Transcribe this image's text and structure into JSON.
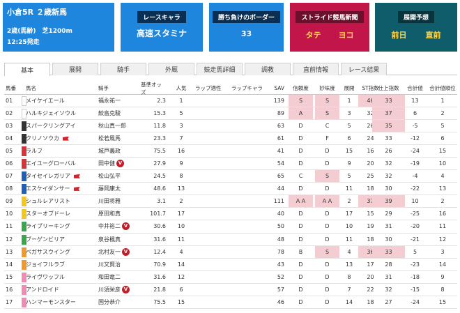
{
  "race_card": {
    "title": "小倉5R ２歳新馬",
    "condition": "2歳(馬齢)　芝1200m",
    "start_time": "12:25発走"
  },
  "chara_card": {
    "header": "レースキャラ",
    "value": "高速スタミナ"
  },
  "border_card": {
    "header": "勝ち負けのボーダー",
    "value": "33"
  },
  "stride_card": {
    "header": "ストライド競馬新聞",
    "left": "タテ",
    "right": "ヨコ"
  },
  "tenkai_card": {
    "header": "展開予想",
    "left": "前日",
    "right": "直前"
  },
  "tabs": [
    "基本",
    "展開",
    "騎手",
    "外厩",
    "競走馬詳細",
    "調教",
    "直前情報",
    "レース結果"
  ],
  "active_tab": 0,
  "columns": [
    "馬番",
    "馬名",
    "騎手",
    "基準オッズ",
    "人気",
    "ラップ適性",
    "ラップキャラ",
    "SAV",
    "信頼度",
    "妙味度",
    "展開",
    "ST指数",
    "仕上指数",
    "合計値",
    "合計値順位"
  ],
  "gate_colors": [
    "#ffffff",
    "#ffffff",
    "#333333",
    "#333333",
    "#d9333a",
    "#d9333a",
    "#1f5fb8",
    "#1f5fb8",
    "#f2c81d",
    "#f2c81d",
    "#39a64b",
    "#39a64b",
    "#f09a2a",
    "#f09a2a",
    "#f08bb5",
    "#f08bb5",
    "#f08bb5"
  ],
  "horses": [
    {
      "no": "01",
      "name": "メイケイエール",
      "jockey": "福永祐一",
      "odds": "2.3",
      "pop": "1",
      "sav": "139",
      "trust": "S",
      "value": "S",
      "tenkai": "1",
      "st": "46",
      "shiage": "33",
      "total": "13",
      "rank": "1",
      "flag": false,
      "vmark": false
    },
    {
      "no": "02",
      "name": "ハルキジェイソウル",
      "jockey": "鮫島克駿",
      "odds": "15.3",
      "pop": "5",
      "sav": "89",
      "trust": "A",
      "value": "S",
      "tenkai": "3",
      "st": "32",
      "shiage": "37",
      "total": "6",
      "rank": "2",
      "flag": false,
      "vmark": false
    },
    {
      "no": "03",
      "name": "スパークリングアイ",
      "jockey": "秋山真一郎",
      "odds": "11.8",
      "pop": "3",
      "sav": "63",
      "trust": "D",
      "value": "C",
      "tenkai": "5",
      "st": "26",
      "shiage": "35",
      "total": "-5",
      "rank": "5",
      "flag": false,
      "vmark": false
    },
    {
      "no": "04",
      "name": "クリノソウカ",
      "jockey": "松若風馬",
      "odds": "23.3",
      "pop": "7",
      "sav": "61",
      "trust": "D",
      "value": "F",
      "tenkai": "6",
      "st": "24",
      "shiage": "33",
      "total": "-12",
      "rank": "6",
      "flag": true,
      "vmark": false
    },
    {
      "no": "05",
      "name": "ラルフ",
      "jockey": "城戸義政",
      "odds": "75.5",
      "pop": "16",
      "sav": "41",
      "trust": "D",
      "value": "D",
      "tenkai": "15",
      "st": "16",
      "shiage": "26",
      "total": "-24",
      "rank": "15",
      "flag": false,
      "vmark": false
    },
    {
      "no": "06",
      "name": "エイユーグローバル",
      "jockey": "田中健",
      "odds": "27.9",
      "pop": "9",
      "sav": "54",
      "trust": "D",
      "value": "D",
      "tenkai": "9",
      "st": "20",
      "shiage": "32",
      "total": "-19",
      "rank": "10",
      "flag": false,
      "vmark": true
    },
    {
      "no": "07",
      "name": "タイセイレガリア",
      "jockey": "松山弘平",
      "odds": "24.5",
      "pop": "8",
      "sav": "65",
      "trust": "C",
      "value": "S",
      "tenkai": "5",
      "st": "25",
      "shiage": "32",
      "total": "-4",
      "rank": "4",
      "flag": true,
      "vmark": false
    },
    {
      "no": "08",
      "name": "エスケイダンサー",
      "jockey": "藤岡康太",
      "odds": "48.6",
      "pop": "13",
      "sav": "44",
      "trust": "D",
      "value": "D",
      "tenkai": "11",
      "st": "18",
      "shiage": "30",
      "total": "-22",
      "rank": "13",
      "flag": true,
      "vmark": false
    },
    {
      "no": "09",
      "name": "シュルレアリスト",
      "jockey": "川田将雅",
      "odds": "3.1",
      "pop": "2",
      "sav": "111",
      "trust": "ＡＡ",
      "value": "ＡＡ",
      "tenkai": "2",
      "st": "37",
      "shiage": "39",
      "total": "10",
      "rank": "2",
      "flag": false,
      "vmark": false
    },
    {
      "no": "10",
      "name": "スターオブドーレ",
      "jockey": "原田和真",
      "odds": "101.7",
      "pop": "17",
      "sav": "40",
      "trust": "D",
      "value": "D",
      "tenkai": "17",
      "st": "15",
      "shiage": "29",
      "total": "-25",
      "rank": "16",
      "flag": false,
      "vmark": false
    },
    {
      "no": "11",
      "name": "ライブリーキング",
      "jockey": "中井裕二",
      "odds": "30.6",
      "pop": "10",
      "sav": "50",
      "trust": "D",
      "value": "D",
      "tenkai": "10",
      "st": "19",
      "shiage": "31",
      "total": "-20",
      "rank": "11",
      "flag": false,
      "vmark": true
    },
    {
      "no": "12",
      "name": "ブーゲンビリア",
      "jockey": "泉谷楓真",
      "odds": "31.6",
      "pop": "11",
      "sav": "48",
      "trust": "D",
      "value": "D",
      "tenkai": "11",
      "st": "18",
      "shiage": "30",
      "total": "-21",
      "rank": "12",
      "flag": false,
      "vmark": false
    },
    {
      "no": "13",
      "name": "ペガサスウイング",
      "jockey": "北村友一",
      "odds": "12.4",
      "pop": "4",
      "sav": "78",
      "trust": "B",
      "value": "S",
      "tenkai": "4",
      "st": "36",
      "shiage": "33",
      "total": "5",
      "rank": "3",
      "flag": false,
      "vmark": true
    },
    {
      "no": "14",
      "name": "ジョイフルラブ",
      "jockey": "川又賢治",
      "odds": "70.9",
      "pop": "14",
      "sav": "43",
      "trust": "D",
      "value": "D",
      "tenkai": "13",
      "st": "17",
      "shiage": "28",
      "total": "-23",
      "rank": "14",
      "flag": false,
      "vmark": false
    },
    {
      "no": "15",
      "name": "ライヴワッフル",
      "jockey": "和田竜二",
      "odds": "31.6",
      "pop": "12",
      "sav": "52",
      "trust": "D",
      "value": "D",
      "tenkai": "8",
      "st": "20",
      "shiage": "31",
      "total": "-18",
      "rank": "9",
      "flag": false,
      "vmark": false
    },
    {
      "no": "16",
      "name": "アンドロイド",
      "jockey": "川須栄彦",
      "odds": "21.8",
      "pop": "6",
      "sav": "57",
      "trust": "D",
      "value": "D",
      "tenkai": "7",
      "st": "22",
      "shiage": "32",
      "total": "-15",
      "rank": "8",
      "flag": false,
      "vmark": true
    },
    {
      "no": "17",
      "name": "ハンマーモンスター",
      "jockey": "国分恭介",
      "odds": "75.5",
      "pop": "15",
      "sav": "46",
      "trust": "D",
      "value": "D",
      "tenkai": "14",
      "st": "18",
      "shiage": "27",
      "total": "-24",
      "rank": "15",
      "flag": false,
      "vmark": false
    }
  ],
  "highlights": {
    "trust": [
      "01",
      "02",
      "09"
    ],
    "value": [
      "01",
      "02",
      "07",
      "09",
      "13"
    ],
    "st": [
      "01",
      "09",
      "13"
    ],
    "shiage": [
      "01",
      "02",
      "03",
      "09",
      "13"
    ]
  }
}
